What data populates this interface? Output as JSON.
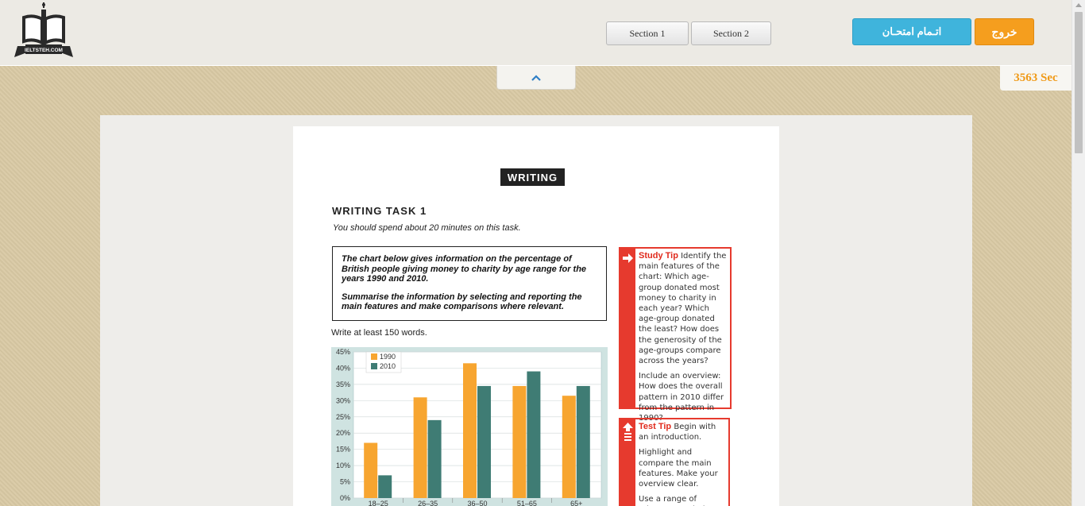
{
  "header": {
    "logo_text": "IELTSTEH.COM",
    "section_tabs": [
      {
        "label": "Section 1"
      },
      {
        "label": "Section 2"
      }
    ],
    "finish_label": "اتـمام امتحـان",
    "exit_label": "خروج",
    "timer": "3563 Sec",
    "colors": {
      "finish": "#3fb4dc",
      "exit": "#f59e1e",
      "timer": "#f09a18"
    }
  },
  "toggle_icon": "chevron-up-icon",
  "document": {
    "heading": "WRITING",
    "task_title": "WRITING TASK 1",
    "task_time": "You should spend about 20 minutes on this task.",
    "prompt_1": "The chart below gives information on the percentage of British people giving money to charity by age range for the years 1990 and 2010.",
    "prompt_2": "Summarise the information by selecting and reporting the main features and make comparisons where relevant.",
    "word_count": "Write at least 150 words.",
    "study_tip": {
      "title": "Study Tip",
      "text_1": "Identify the main features of the chart: Which age-group donated most money to charity in each year? Which age-group donated the least? How does the generosity of the age-groups compare across the years?",
      "text_2": "Include an overview: How does the overall pattern in 2010 differ from the pattern in 1990?"
    },
    "test_tip": {
      "title": "Test Tip",
      "text_1": "Begin with an introduction.",
      "text_2": "Highlight and compare the main features. Make your overview clear.",
      "text_3": "Use a range of relevant vocabulary and try to"
    }
  },
  "chart_data": {
    "type": "bar",
    "categories": [
      "18–25",
      "26–35",
      "36–50",
      "51–65",
      "65+"
    ],
    "series": [
      {
        "name": "1990",
        "values": [
          17,
          31,
          41.5,
          34.5,
          31.5
        ],
        "color": "#f7a530"
      },
      {
        "name": "2010",
        "values": [
          7,
          24,
          34.5,
          39,
          34.5
        ],
        "color": "#3f7c74"
      }
    ],
    "y_ticks": [
      "0%",
      "5%",
      "10%",
      "15%",
      "20%",
      "25%",
      "30%",
      "35%",
      "40%",
      "45%"
    ],
    "ylim": [
      0,
      45
    ],
    "legend": "top-left",
    "grid": true
  }
}
